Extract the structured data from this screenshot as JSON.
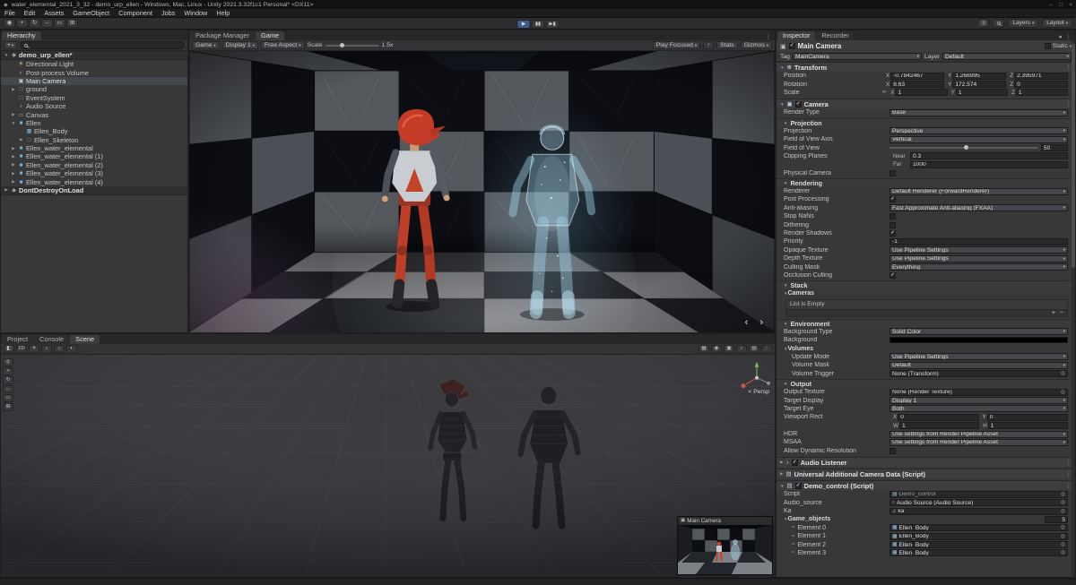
{
  "window": {
    "title": "water_elemental_2021_3_32 - demo_urp_ellen - Windows, Mac, Linux - Unity 2021.3.32f1c1 Personal* <DX11>",
    "menus": [
      "File",
      "Edit",
      "Assets",
      "GameObject",
      "Component",
      "Jobs",
      "Window",
      "Help"
    ],
    "tool_icons": [
      "hand-tool",
      "move-tool",
      "rotate-tool",
      "scale-tool",
      "rect-tool",
      "transform-tool"
    ],
    "layers_label": "Layers",
    "layout_label": "Layout"
  },
  "hierarchy": {
    "tabs": [
      {
        "label": "Hierarchy",
        "active": true
      }
    ],
    "scene_name": "demo_urp_ellen*",
    "dontdestroy_name": "DontDestroyOnLoad",
    "items": [
      {
        "label": "Directional Light",
        "indent": 1,
        "icon": "light",
        "arrow": false
      },
      {
        "label": "Post-process Volume",
        "indent": 1,
        "icon": "volume",
        "arrow": false
      },
      {
        "label": "Main Camera",
        "indent": 1,
        "icon": "camera",
        "arrow": false,
        "selected": true
      },
      {
        "label": "ground",
        "indent": 1,
        "icon": "gameobject",
        "arrow": true
      },
      {
        "label": "EventSystem",
        "indent": 1,
        "icon": "gameobject",
        "arrow": false
      },
      {
        "label": "Audio Source",
        "indent": 1,
        "icon": "audio",
        "arrow": false
      },
      {
        "label": "Canvas",
        "indent": 1,
        "icon": "canvas",
        "arrow": true
      },
      {
        "label": "Ellen",
        "indent": 1,
        "icon": "prefab",
        "arrow": true,
        "expanded": true
      },
      {
        "label": "Ellen_Body",
        "indent": 2,
        "icon": "mesh",
        "arrow": false
      },
      {
        "label": "Ellen_Skeleton",
        "indent": 2,
        "icon": "gameobject",
        "arrow": true
      },
      {
        "label": "Ellen_water_elemental",
        "indent": 1,
        "icon": "prefab",
        "arrow": true
      },
      {
        "label": "Ellen_water_elemental (1)",
        "indent": 1,
        "icon": "prefab",
        "arrow": true
      },
      {
        "label": "Ellen_water_elemental (2)",
        "indent": 1,
        "icon": "prefab",
        "arrow": true
      },
      {
        "label": "Ellen_water_elemental (3)",
        "indent": 1,
        "icon": "prefab",
        "arrow": true
      },
      {
        "label": "Ellen_water_elemental (4)",
        "indent": 1,
        "icon": "prefab",
        "arrow": true
      }
    ]
  },
  "game_panel": {
    "tabs": [
      {
        "label": "Package Manager",
        "active": false
      },
      {
        "label": "Game",
        "active": true
      }
    ],
    "toolbar": {
      "mode": "Game",
      "display": "Display 1",
      "aspect": "Free Aspect",
      "scale_label": "Scale",
      "scale_value": "1.5x",
      "play_focused": "Play Focused",
      "stats": "Stats",
      "gizmos": "Gizmos"
    },
    "nav_arrows": "‹ ›"
  },
  "scene_panel": {
    "tabs": [
      {
        "label": "Project",
        "active": false
      },
      {
        "label": "Console",
        "active": false
      },
      {
        "label": "Scene",
        "active": true
      }
    ],
    "toolbar_left_icons": [
      "draw-mode",
      "2d",
      "lighting",
      "audio",
      "effects",
      "hidden"
    ],
    "toolbar_right_icons": [
      "grid",
      "gizmo",
      "camera",
      "audio",
      "overlay",
      "more"
    ],
    "side_tools": [
      "view-tool",
      "move-tool",
      "rotate-tool",
      "scale-tool",
      "rect-tool",
      "transform-tool"
    ],
    "persp_label": "< Persp",
    "camera_preview_title": "Main Camera"
  },
  "inspector": {
    "tabs": [
      {
        "label": "Inspector",
        "active": true
      },
      {
        "label": "Recorder",
        "active": false
      }
    ],
    "header": {
      "name": "Main Camera",
      "static_label": "Static"
    },
    "tag_layer": {
      "tag_label": "Tag",
      "tag_value": "MainCamera",
      "layer_label": "Layer",
      "layer_value": "Default"
    },
    "transform": {
      "title": "Transform",
      "rows": [
        {
          "label": "Position",
          "x": "-0.7842467",
          "y": "1.266995",
          "z": "2.395971"
        },
        {
          "label": "Rotation",
          "x": "8.63",
          "y": "172.574",
          "z": "0"
        },
        {
          "label": "Scale",
          "link": true,
          "x": "1",
          "y": "1",
          "z": "1"
        }
      ]
    },
    "camera": {
      "title": "Camera",
      "rows": [
        {
          "t": "drop",
          "label": "Render Type",
          "value": "Base"
        },
        {
          "t": "sub",
          "label": "Projection"
        },
        {
          "t": "drop",
          "label": "Projection",
          "value": "Perspective"
        },
        {
          "t": "drop",
          "label": "Field of View Axis",
          "value": "Vertical"
        },
        {
          "t": "slider",
          "label": "Field of View",
          "value": "50"
        },
        {
          "t": "pair",
          "label": "Clipping Planes",
          "sub": "Near",
          "value": "0.3"
        },
        {
          "t": "pair",
          "label": "",
          "sub": "Far",
          "value": "1000"
        },
        {
          "t": "check",
          "label": "Physical Camera",
          "on": false
        },
        {
          "t": "sub",
          "label": "Rendering"
        },
        {
          "t": "drop",
          "label": "Renderer",
          "value": "Default Renderer (ForwardRenderer)"
        },
        {
          "t": "check",
          "label": "Post Processing",
          "on": true
        },
        {
          "t": "drop",
          "label": "Anti-aliasing",
          "value": "Fast Approximate Anti-aliasing (FXAA)"
        },
        {
          "t": "check",
          "label": "Stop NaNs",
          "on": false
        },
        {
          "t": "check",
          "label": "Dithering",
          "on": false
        },
        {
          "t": "check",
          "label": "Render Shadows",
          "on": true
        },
        {
          "t": "field",
          "label": "Priority",
          "value": "-1"
        },
        {
          "t": "drop",
          "label": "Opaque Texture",
          "value": "Use Pipeline Settings"
        },
        {
          "t": "drop",
          "label": "Depth Texture",
          "value": "Use Pipeline Settings"
        },
        {
          "t": "drop",
          "label": "Culling Mask",
          "value": "Everything"
        },
        {
          "t": "check",
          "label": "Occlusion Culling",
          "on": true
        },
        {
          "t": "sub",
          "label": "Stack"
        },
        {
          "t": "fold",
          "label": "Cameras"
        },
        {
          "t": "stackbox",
          "empty": "List is Empty"
        },
        {
          "t": "sub",
          "label": "Environment"
        },
        {
          "t": "drop",
          "label": "Background Type",
          "value": "Solid Color"
        },
        {
          "t": "color",
          "label": "Background",
          "value": "#000000"
        },
        {
          "t": "fold",
          "label": "Volumes"
        },
        {
          "t": "drop",
          "label": "Update Mode",
          "value": "Use Pipeline Settings",
          "ind": true
        },
        {
          "t": "drop",
          "label": "Volume Mask",
          "value": "Default",
          "ind": true
        },
        {
          "t": "obj",
          "label": "Volume Trigger",
          "value": "None (Transform)",
          "ind": true
        },
        {
          "t": "sub",
          "label": "Output"
        },
        {
          "t": "obj",
          "label": "Output Texture",
          "value": "None (Render Texture)"
        },
        {
          "t": "drop",
          "label": "Target Display",
          "value": "Display 1"
        },
        {
          "t": "drop",
          "label": "Target Eye",
          "value": "Both"
        },
        {
          "t": "rect",
          "label": "Viewport Rect",
          "a": "X",
          "av": "0",
          "b": "Y",
          "bv": "0"
        },
        {
          "t": "rect",
          "label": "",
          "a": "W",
          "av": "1",
          "b": "H",
          "bv": "1"
        },
        {
          "t": "drop",
          "label": "HDR",
          "value": "Use settings from Render Pipeline Asset"
        },
        {
          "t": "drop",
          "label": "MSAA",
          "value": "Use settings from Render Pipeline Asset"
        },
        {
          "t": "check",
          "label": "Allow Dynamic Resolution",
          "on": false
        }
      ]
    },
    "extra_components": [
      {
        "title": "Audio Listener",
        "icon": "audio",
        "check": true,
        "collapsed": true,
        "rows": []
      },
      {
        "title": "Universal Additional Camera Data (Script)",
        "icon": "script",
        "collapsed": true,
        "rows": []
      },
      {
        "title": "Demo_control (Script)",
        "icon": "script",
        "check": true,
        "rows": [
          {
            "t": "obj",
            "label": "Script",
            "value": "Demo_control",
            "icon": "script",
            "muted": true
          },
          {
            "t": "obj",
            "label": "Audio_source",
            "value": "Audio Source (Audio Source)",
            "icon": "audio"
          },
          {
            "t": "obj",
            "label": "Ka",
            "value": "ka",
            "icon": "clip"
          },
          {
            "t": "list",
            "label": "Game_objects",
            "count": "5"
          },
          {
            "t": "obj",
            "label": "Element 0",
            "value": "Ellen_Body",
            "icon": "mesh",
            "ind": true,
            "drag": true
          },
          {
            "t": "obj",
            "label": "Element 1",
            "value": "Ellen_Body",
            "icon": "mesh",
            "ind": true,
            "drag": true
          },
          {
            "t": "obj",
            "label": "Element 2",
            "value": "Ellen_Body",
            "icon": "mesh",
            "ind": true,
            "drag": true
          },
          {
            "t": "obj",
            "label": "Element 3",
            "value": "Ellen_Body",
            "icon": "mesh",
            "ind": true,
            "drag": true
          }
        ]
      }
    ]
  },
  "colors": {
    "accent_blue": "#3e5f8a",
    "prefab_blue": "#6fb3e0",
    "ellen_red": "#c43b28",
    "elemental_blue": "#a8ddf2",
    "selection_gray": "#44484c"
  }
}
